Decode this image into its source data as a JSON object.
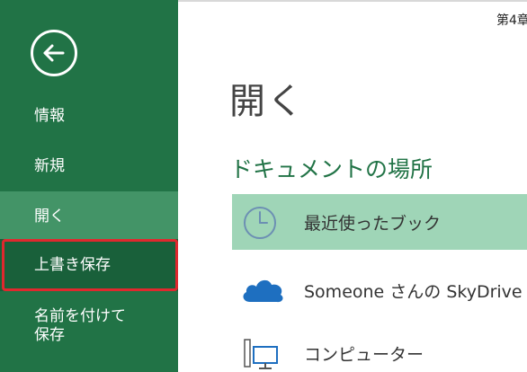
{
  "header": {
    "corner_text": "第4章"
  },
  "sidebar": {
    "items": [
      {
        "label": "情報"
      },
      {
        "label": "新規"
      },
      {
        "label": "開く"
      },
      {
        "label": "上書き保存"
      },
      {
        "label_line1": "名前を付けて",
        "label_line2": "保存"
      }
    ]
  },
  "main": {
    "title": "開く",
    "section_title": "ドキュメントの場所",
    "locations": [
      {
        "label": "最近使ったブック",
        "icon": "clock-icon"
      },
      {
        "label": "Someone さんの SkyDrive",
        "icon": "cloud-icon"
      },
      {
        "label": "コンピューター",
        "icon": "computer-icon"
      }
    ]
  },
  "colors": {
    "sidebar_bg": "#217346",
    "selected_item_bg": "#439467",
    "save_item_bg": "#19603a",
    "highlight_border": "#e0282e",
    "recent_bg": "#9fd5b7",
    "accent": "#217346",
    "cloud": "#1e6fc0"
  }
}
